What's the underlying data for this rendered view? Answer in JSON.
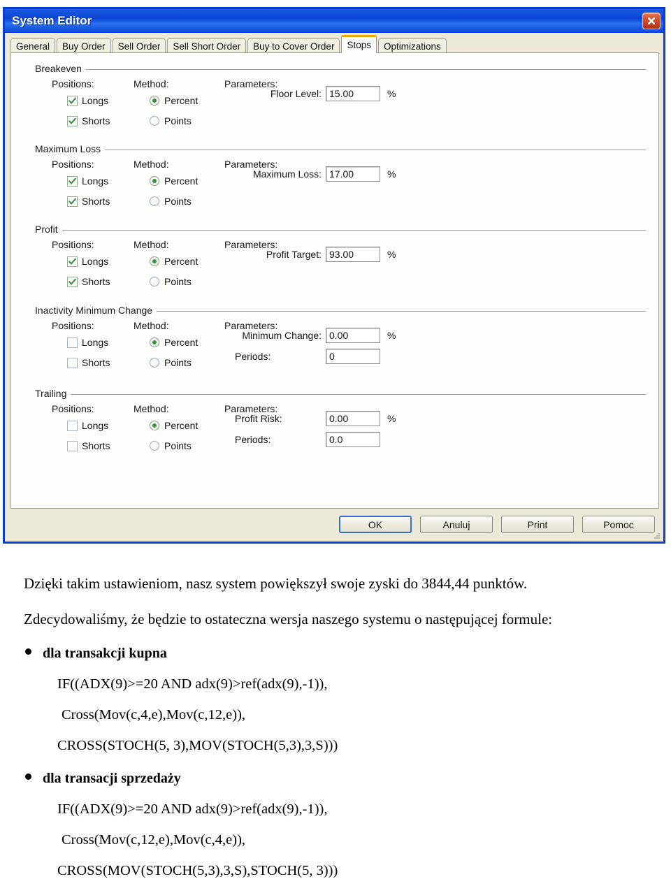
{
  "window": {
    "title": "System Editor",
    "close_icon": "close-x-icon"
  },
  "tabs": [
    {
      "label": "General",
      "active": false
    },
    {
      "label": "Buy Order",
      "active": false
    },
    {
      "label": "Sell Order",
      "active": false
    },
    {
      "label": "Sell Short Order",
      "active": false
    },
    {
      "label": "Buy to Cover Order",
      "active": false
    },
    {
      "label": "Stops",
      "active": true
    },
    {
      "label": "Optimizations",
      "active": false
    }
  ],
  "column_headers": {
    "positions": "Positions:",
    "method": "Method:",
    "parameters": "Parameters:"
  },
  "labels": {
    "longs": "Longs",
    "shorts": "Shorts",
    "percent": "Percent",
    "points": "Points",
    "percent_sign": "%"
  },
  "groups": [
    {
      "title": "Breakeven",
      "longs_checked": true,
      "shorts_checked": true,
      "method": "Percent",
      "params": [
        {
          "label": "Floor Level:",
          "value": "15.00",
          "unit": "%"
        }
      ]
    },
    {
      "title": "Maximum Loss",
      "longs_checked": true,
      "shorts_checked": true,
      "method": "Percent",
      "params": [
        {
          "label": "Maximum Loss:",
          "value": "17.00",
          "unit": "%"
        }
      ]
    },
    {
      "title": "Profit",
      "longs_checked": true,
      "shorts_checked": true,
      "method": "Percent",
      "params": [
        {
          "label": "Profit Target:",
          "value": "93.00",
          "unit": "%"
        }
      ]
    },
    {
      "title": "Inactivity Minimum Change",
      "longs_checked": false,
      "shorts_checked": false,
      "method": "Percent",
      "params": [
        {
          "label": "Minimum Change:",
          "value": "0.00",
          "unit": "%"
        },
        {
          "label": "Periods:",
          "value": "0",
          "unit": ""
        }
      ]
    },
    {
      "title": "Trailing",
      "longs_checked": false,
      "shorts_checked": false,
      "method": "Percent",
      "params": [
        {
          "label": "Profit Risk:",
          "value": "0.00",
          "unit": "%"
        },
        {
          "label": "Periods:",
          "value": "0.0",
          "unit": ""
        }
      ]
    }
  ],
  "footer_buttons": [
    {
      "label": "OK",
      "default": true
    },
    {
      "label": "Anuluj",
      "default": false
    },
    {
      "label": "Print",
      "default": false
    },
    {
      "label": "Pomoc",
      "default": false
    }
  ],
  "document": {
    "paragraph_1": "Dzięki takim ustawieniom, nasz system powiększył swoje zyski do 3844,44 punktów.",
    "paragraph_2": "Zdecydowaliśmy, że będzie to ostateczna wersja naszego systemu o następującej formule:",
    "bullet_1": "dla transakcji kupna",
    "buy_formula_line_1": "IF((ADX(9)>=20 AND adx(9)>ref(adx(9),-1)),",
    "buy_formula_line_2": "Cross(Mov(c,4,e),Mov(c,12,e)),",
    "buy_formula_line_3": "CROSS(STOCH(5, 3),MOV(STOCH(5,3),3,S)))",
    "bullet_2": "dla transacji sprzedaży",
    "sell_formula_line_1": "IF((ADX(9)>=20 AND adx(9)>ref(adx(9),-1)),",
    "sell_formula_line_2": "Cross(Mov(c,12,e),Mov(c,4,e)),",
    "sell_formula_line_3": "CROSS(MOV(STOCH(5,3),3,S),STOCH(5, 3)))"
  },
  "colors": {
    "titlebar_blue": "#0b46d4",
    "active_tab_accent": "#f0a800",
    "check_green": "#3e8c3e",
    "dialog_face": "#ece9d8"
  }
}
